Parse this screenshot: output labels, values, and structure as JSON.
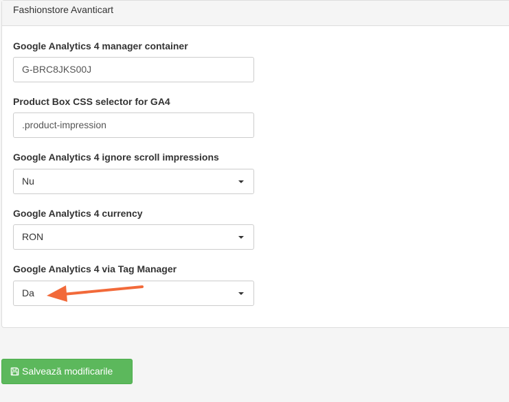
{
  "panel": {
    "title": "Fashionstore Avanticart"
  },
  "fields": {
    "gtm_container": {
      "label": "Google Analytics 4 manager container",
      "value": "G-BRC8JKS00J"
    },
    "product_box_selector": {
      "label": "Product Box CSS selector for GA4",
      "value": ".product-impression"
    },
    "ignore_scroll": {
      "label": "Google Analytics 4 ignore scroll impressions",
      "selected": "Nu"
    },
    "currency": {
      "label": "Google Analytics 4 currency",
      "selected": "RON"
    },
    "via_tag_manager": {
      "label": "Google Analytics 4 via Tag Manager",
      "selected": "Da"
    }
  },
  "actions": {
    "save_label": "Salvează modificarile"
  },
  "icons": {
    "save": "floppy-disk-icon",
    "dropdown": "caret-down-icon",
    "annotation": "arrow-annotation"
  },
  "colors": {
    "save_button": "#5cb85c",
    "annotation_arrow": "#f26a3a"
  }
}
